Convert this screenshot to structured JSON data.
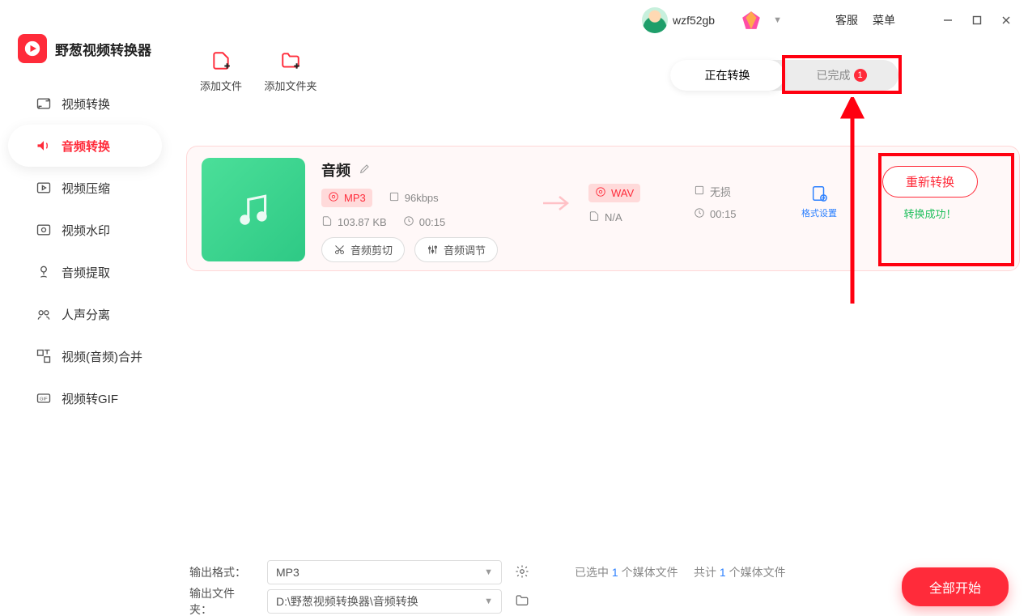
{
  "titlebar": {
    "username": "wzf52gb",
    "link_support": "客服",
    "link_menu": "菜单"
  },
  "brand": {
    "name": "野葱视频转换器"
  },
  "sidebar": {
    "items": [
      {
        "label": "视频转换"
      },
      {
        "label": "音频转换"
      },
      {
        "label": "视频压缩"
      },
      {
        "label": "视频水印"
      },
      {
        "label": "音频提取"
      },
      {
        "label": "人声分离"
      },
      {
        "label": "视频(音频)合并"
      },
      {
        "label": "视频转GIF"
      }
    ],
    "active_index": 1
  },
  "toolbar": {
    "add_file": "添加文件",
    "add_folder": "添加文件夹"
  },
  "tabs": {
    "converting": "正在转换",
    "completed": "已完成",
    "completed_count": "1"
  },
  "file": {
    "title": "音频",
    "src_format": "MP3",
    "src_bitrate": "96kbps",
    "src_size": "103.87 KB",
    "src_duration": "00:15",
    "btn_cut": "音频剪切",
    "btn_tune": "音频调节",
    "dst_format": "WAV",
    "dst_size": "N/A",
    "dst_quality": "无损",
    "dst_duration": "00:15",
    "format_settings": "格式设置",
    "reconvert": "重新转换",
    "success": "转换成功！"
  },
  "footer": {
    "out_format_label": "输出格式：",
    "out_format_value": "MP3",
    "out_folder_label": "输出文件夹：",
    "out_folder_value": "D:\\野葱视频转换器\\音频转换",
    "stats_selected_prefix": "已选中 ",
    "stats_selected_count": "1",
    "stats_selected_suffix": " 个媒体文件",
    "stats_total_prefix": "共计 ",
    "stats_total_count": "1",
    "stats_total_suffix": " 个媒体文件",
    "start_all": "全部开始"
  }
}
